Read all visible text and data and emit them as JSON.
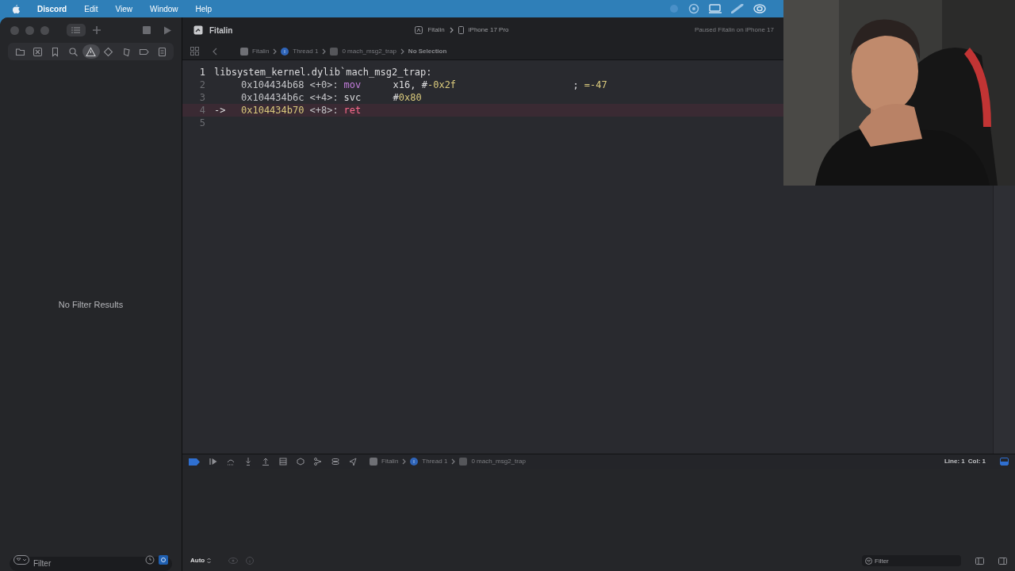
{
  "menubar": {
    "items": [
      "Discord",
      "Edit",
      "View",
      "Window",
      "Help"
    ]
  },
  "toolbar": {
    "title": "Fitalin",
    "scheme": {
      "target": "Fitalin",
      "device": "iPhone 17 Pro"
    },
    "status": "Paused Fitalin on iPhone 17"
  },
  "navigator": {
    "tabs": [
      {
        "kind": "folder",
        "selected": false
      },
      {
        "kind": "source",
        "selected": false
      },
      {
        "kind": "bookmark",
        "selected": false
      },
      {
        "kind": "search",
        "selected": false
      },
      {
        "kind": "warning",
        "selected": true
      },
      {
        "kind": "test",
        "selected": false
      },
      {
        "kind": "debug",
        "selected": false
      },
      {
        "kind": "breakpoint",
        "selected": false
      },
      {
        "kind": "report",
        "selected": false
      }
    ],
    "message": "No Filter Results",
    "filter": {
      "placeholder": "Filter"
    }
  },
  "jump_bar": {
    "path": [
      {
        "kind": "app",
        "text": "Fitalin"
      },
      {
        "kind": "thread",
        "text": "Thread 1"
      },
      {
        "kind": "frame",
        "text": "0 mach_msg2_trap"
      }
    ],
    "selection": "No Selection"
  },
  "editor": {
    "lines": [
      {
        "number": "1",
        "current": false,
        "label": "libsystem_kernel.dylib`mach_msg2_trap:"
      },
      {
        "number": "2",
        "current": false,
        "address": "0x104434b68",
        "offset": "<+0>:",
        "mnemonic": {
          "text": "mov",
          "kind": "keyword"
        },
        "operands": [
          {
            "text": "x16, #",
            "kind": "plain"
          },
          {
            "text": "-0x2f",
            "kind": "number"
          }
        ],
        "comment": [
          {
            "text": ";",
            "kind": "plain"
          },
          {
            "text": "=-47",
            "kind": "number"
          }
        ]
      },
      {
        "number": "3",
        "current": false,
        "address": "0x104434b6c",
        "offset": "<+4>:",
        "mnemonic": {
          "text": "svc",
          "kind": "plain"
        },
        "operands": [
          {
            "text": "#",
            "kind": "plain"
          },
          {
            "text": "0x80",
            "kind": "number"
          }
        ]
      },
      {
        "number": "4",
        "current": true,
        "marker": "->",
        "address": "0x104434b70",
        "offset": "<+8>:",
        "mnemonic": {
          "text": "ret",
          "kind": "return"
        }
      },
      {
        "number": "5",
        "current": false
      }
    ]
  },
  "debug_bar": {
    "breakpoints_enabled": true,
    "path": [
      {
        "kind": "app",
        "text": "Fitalin"
      },
      {
        "kind": "thread",
        "text": "Thread 1"
      },
      {
        "kind": "frame",
        "text": "0 mach_msg2_trap"
      }
    ],
    "line": "Line: 1",
    "column": "Col: 1"
  },
  "console": {
    "scope": "Auto",
    "filter": {
      "placeholder": "Filter"
    }
  }
}
